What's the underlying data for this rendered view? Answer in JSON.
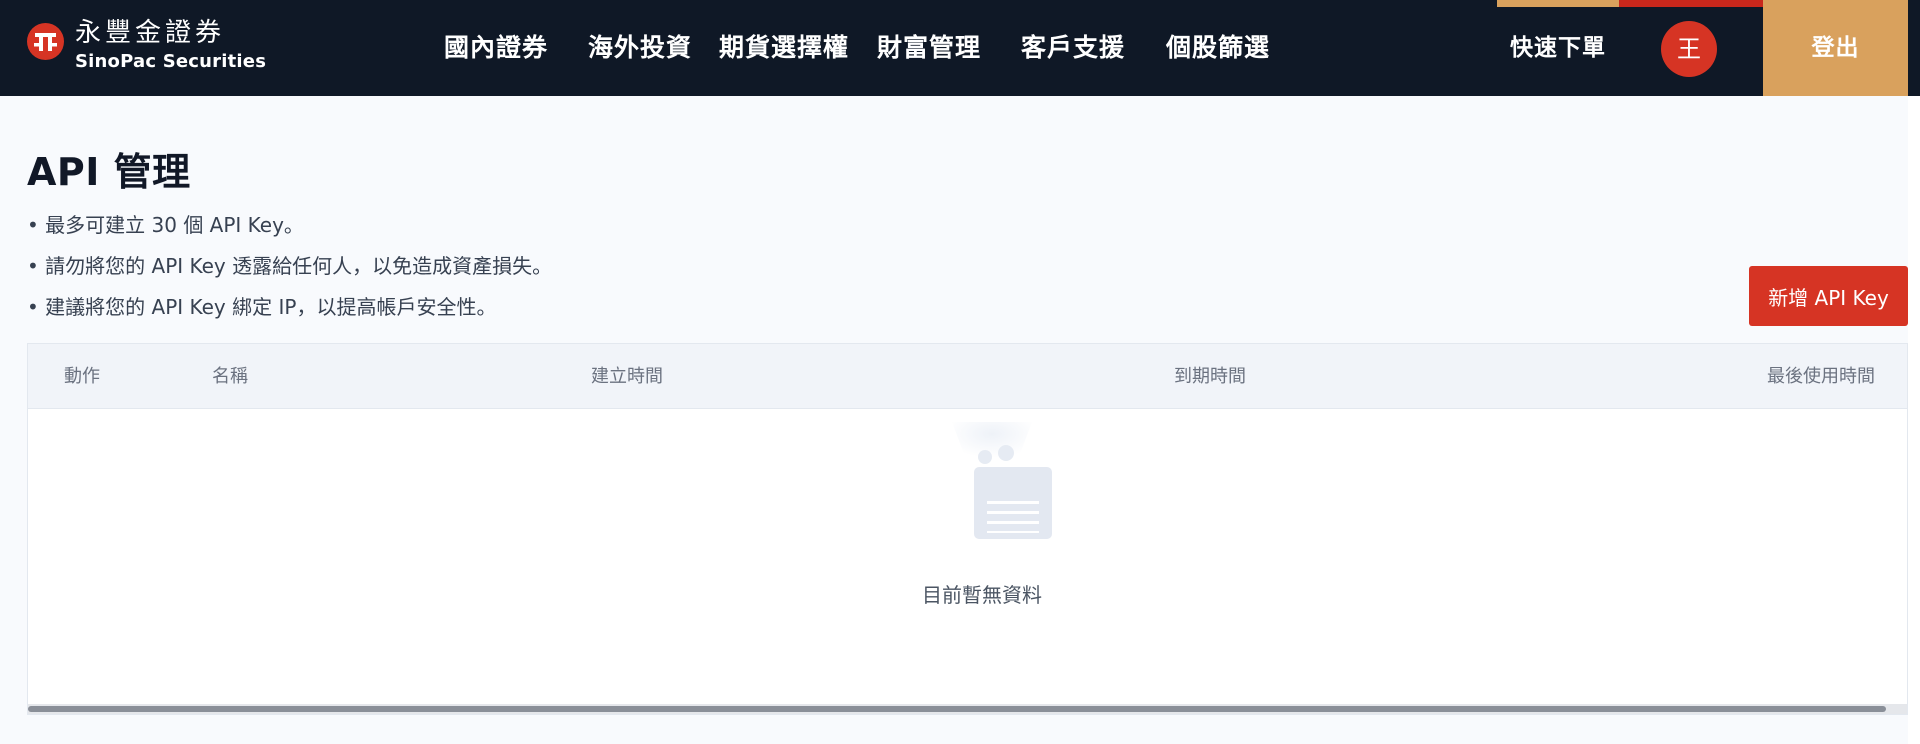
{
  "header": {
    "brand_cn": "永豐金證券",
    "brand_en": "SinoPac Securities",
    "nav": [
      {
        "label": "國內證券"
      },
      {
        "label": "海外投資"
      },
      {
        "label": "期貨選擇權"
      },
      {
        "label": "財富管理"
      },
      {
        "label": "客戶支援"
      },
      {
        "label": "個股篩選"
      }
    ],
    "quick_order": "快速下單",
    "avatar_initial": "王",
    "logout": "登出"
  },
  "page": {
    "title": "API 管理",
    "notes": [
      "• 最多可建立 30 個 API Key。",
      "• 請勿將您的 API Key 透露給任何人，以免造成資產損失。",
      "• 建議將您的 API Key 綁定 IP，以提高帳戶安全性。"
    ],
    "new_key_button": "新增 API Key"
  },
  "table": {
    "columns": [
      "動作",
      "名稱",
      "建立時間",
      "到期時間",
      "最後使用時間"
    ],
    "rows": [],
    "empty_text": "目前暫無資料"
  },
  "colors": {
    "header_bg": "#0f1826",
    "accent_red": "#d63424",
    "accent_gold": "#d9a15d",
    "page_bg": "#f8fafd"
  }
}
